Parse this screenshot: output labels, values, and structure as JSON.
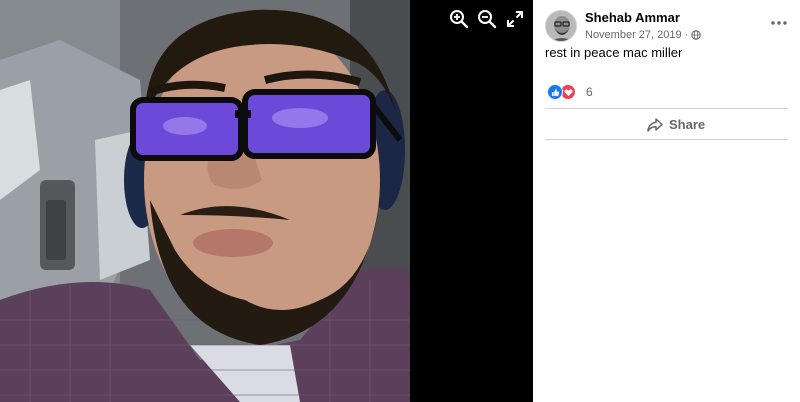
{
  "viewer": {
    "icons": [
      "zoom-in-icon",
      "zoom-out-icon",
      "fullscreen-icon"
    ]
  },
  "post": {
    "author": "Shehab Ammar",
    "date": "November 27, 2019",
    "separator": "·",
    "privacy_icon": "globe-icon",
    "more_icon": "more-horizontal-icon",
    "text": "rest in peace mac miller",
    "reactions": {
      "types": [
        "like",
        "love"
      ],
      "count": "6"
    },
    "actions": {
      "share_label": "Share"
    }
  },
  "colors": {
    "like": "#1877f2",
    "love": "#f33e58",
    "secondary_text": "#65676b",
    "viewer_bg": "#000000"
  }
}
